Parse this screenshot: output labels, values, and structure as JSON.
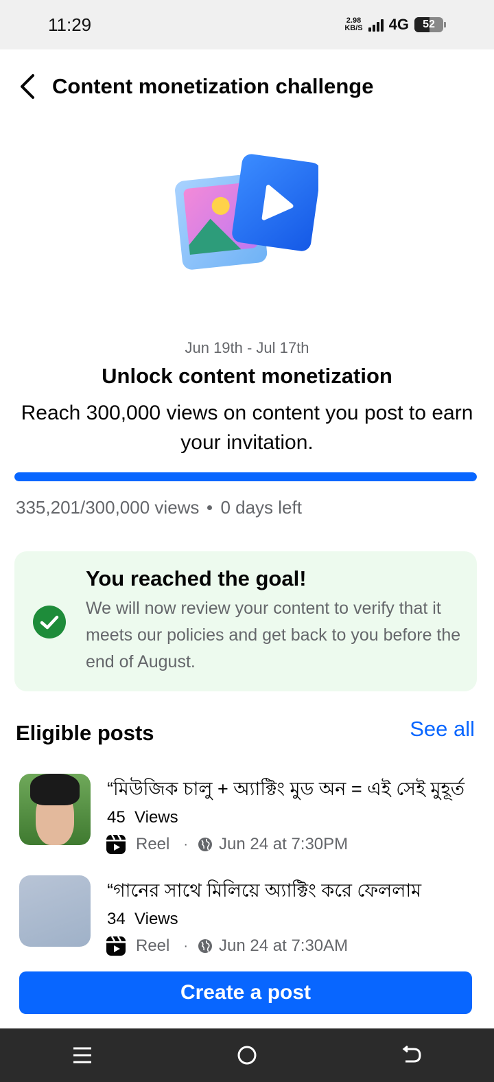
{
  "status_bar": {
    "time": "11:29",
    "net_speed_value": "2.98",
    "net_speed_unit": "KB/S",
    "network_type": "4G",
    "battery": "52",
    "battery_level": 0.52
  },
  "header": {
    "title": "Content monetization challenge"
  },
  "challenge": {
    "date_range": "Jun 19th - Jul 17th",
    "headline": "Unlock content monetization",
    "description": "Reach 300,000 views on content you post to earn your invitation.",
    "progress_fraction": 1.0,
    "views_text": "335,201/300,000 views",
    "days_left": "0 days left"
  },
  "goal_card": {
    "title": "You reached the goal!",
    "body": "We will now review your content to verify that it meets our policies and get back to you before the end of August."
  },
  "eligible_posts": {
    "title": "Eligible posts",
    "see_all": "See all",
    "items": [
      {
        "caption": "“মিউজিক চালু + অ্যাক্টিং মুড অন = এই সেই মুহূর্ত",
        "views_count": "45",
        "views_label": "Views",
        "type": "Reel",
        "dot": "·",
        "date": "Jun 24 at 7:30PM"
      },
      {
        "caption": "“গানের সাথে মিলিয়ে অ্যাক্টিং করে ফেললাম",
        "views_count": "34",
        "views_label": "Views",
        "type": "Reel",
        "dot": "·",
        "date": "Jun 24 at 7:30AM"
      }
    ]
  },
  "create_button": "Create a post",
  "colors": {
    "accent": "#0866ff",
    "success": "#1e8c3a",
    "goal_card_bg": "#edfaee",
    "secondary_text": "#65676b"
  }
}
